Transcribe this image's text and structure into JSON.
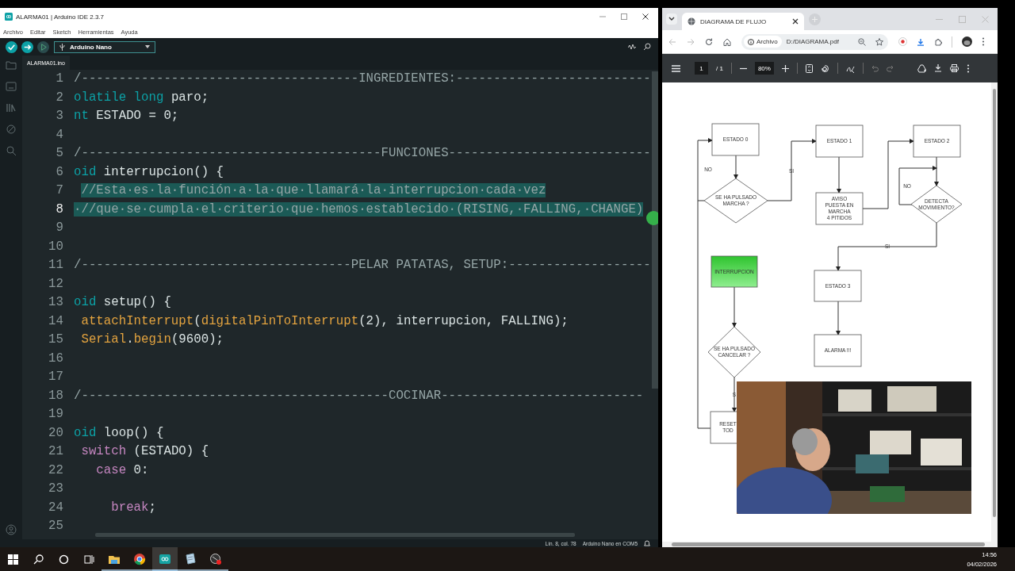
{
  "ide": {
    "title": "ALARMA01 | Arduino IDE 2.3.7",
    "menu": [
      "Archivo",
      "Editar",
      "Sketch",
      "Herramientas",
      "Ayuda"
    ],
    "toolbar_buttons": [
      {
        "kind": "verify",
        "disabled": false
      },
      {
        "kind": "upload",
        "disabled": false
      },
      {
        "kind": "debug",
        "disabled": true
      }
    ],
    "board": "Arduino Nano",
    "file_tab": "ALARMA01.ino",
    "code_lines": [
      {
        "number": "1",
        "current": false,
        "selected": false,
        "segments": [
          {
            "kind": "comment",
            "text": "/-------------------------------------INGREDIENTES:--------------------------"
          }
        ]
      },
      {
        "number": "2",
        "current": false,
        "selected": false,
        "segments": [
          {
            "kind": "keyword",
            "text": "olatile"
          },
          {
            "kind": "keyword",
            "text": " long"
          },
          {
            "kind": "plain",
            "text": " paro;"
          }
        ]
      },
      {
        "number": "3",
        "current": false,
        "selected": false,
        "segments": [
          {
            "kind": "keyword",
            "text": "nt"
          },
          {
            "kind": "plain",
            "text": " ESTADO = 0;"
          }
        ]
      },
      {
        "number": "4",
        "current": false,
        "selected": false
      },
      {
        "number": "5",
        "current": false,
        "selected": false,
        "segments": [
          {
            "kind": "comment",
            "text": "/----------------------------------------FUNCIONES---------------------------"
          }
        ]
      },
      {
        "number": "6",
        "current": false,
        "selected": false,
        "segments": [
          {
            "kind": "keyword",
            "text": "oid"
          },
          {
            "kind": "plain",
            "text": " interrupcion() {"
          }
        ]
      },
      {
        "number": "7",
        "current": false,
        "selected": true,
        "segments": [
          {
            "kind": "comment",
            "text": " //Esta·es·la·función·a·la·que·llamará·la·interrupcion·cada·vez"
          }
        ]
      },
      {
        "number": "8",
        "current": true,
        "selected": true,
        "segments": [
          {
            "kind": "comment",
            "text": "·//que·se·cumpla·el·criterio·que·hemos·establecido·(RISING,·FALLING,·CHANGE)"
          }
        ]
      },
      {
        "number": "9",
        "current": false,
        "selected": false
      },
      {
        "number": "10",
        "current": false,
        "selected": false
      },
      {
        "number": "11",
        "current": false,
        "selected": false,
        "segments": [
          {
            "kind": "comment",
            "text": "/------------------------------------PELAR PATATAS, SETUP:-------------------"
          }
        ]
      },
      {
        "number": "12",
        "current": false,
        "selected": false
      },
      {
        "number": "13",
        "current": false,
        "selected": false,
        "segments": [
          {
            "kind": "keyword",
            "text": "oid"
          },
          {
            "kind": "plain",
            "text": " setup() {"
          }
        ]
      },
      {
        "number": "14",
        "current": false,
        "selected": false,
        "segments": [
          {
            "kind": "builtin",
            "text": " attachInterrupt"
          },
          {
            "kind": "plain",
            "text": "("
          },
          {
            "kind": "builtin",
            "text": "digitalPinToInterrupt"
          },
          {
            "kind": "plain",
            "text": "(2), interrupcion, FALLING);"
          }
        ]
      },
      {
        "number": "15",
        "current": false,
        "selected": false,
        "segments": [
          {
            "kind": "builtin",
            "text": " Serial"
          },
          {
            "kind": "plain",
            "text": "."
          },
          {
            "kind": "builtin",
            "text": "begin"
          },
          {
            "kind": "plain",
            "text": "(9600);"
          }
        ]
      },
      {
        "number": "16",
        "current": false,
        "selected": false
      },
      {
        "number": "17",
        "current": false,
        "selected": false
      },
      {
        "number": "18",
        "current": false,
        "selected": false,
        "segments": [
          {
            "kind": "comment",
            "text": "/-----------------------------------------COCINAR---------------------------"
          }
        ]
      },
      {
        "number": "19",
        "current": false,
        "selected": false
      },
      {
        "number": "20",
        "current": false,
        "selected": false,
        "segments": [
          {
            "kind": "keyword",
            "text": "oid"
          },
          {
            "kind": "plain",
            "text": " loop() {"
          }
        ]
      },
      {
        "number": "21",
        "current": false,
        "selected": false,
        "segments": [
          {
            "kind": "control",
            "text": " switch"
          },
          {
            "kind": "plain",
            "text": " (ESTADO) {"
          }
        ]
      },
      {
        "number": "22",
        "current": false,
        "selected": false,
        "segments": [
          {
            "kind": "control",
            "text": "   case"
          },
          {
            "kind": "plain",
            "text": " 0:"
          }
        ]
      },
      {
        "number": "23",
        "current": false,
        "selected": false
      },
      {
        "number": "24",
        "current": false,
        "selected": false,
        "segments": [
          {
            "kind": "control",
            "text": "     break"
          },
          {
            "kind": "plain",
            "text": ";"
          }
        ]
      },
      {
        "number": "25",
        "current": false,
        "selected": false
      }
    ],
    "status_bar": {
      "position": "Lín. 8, col. 78",
      "board_port": "Arduino Nano en COM5"
    }
  },
  "browser": {
    "tab": {
      "title": "DIAGRAMA DE FLUJO"
    },
    "address": {
      "chip": "Archivo",
      "url": "D:/DIAGRAMA.pdf"
    },
    "pdf_toolbar": {
      "page": "1",
      "page_count": "/ 1",
      "zoom": "80%"
    },
    "flowchart": {
      "nodes": [
        {
          "kind": "box",
          "lines": [
            "ESTADO 0"
          ]
        },
        {
          "kind": "box",
          "lines": [
            "ESTADO 1"
          ]
        },
        {
          "kind": "box",
          "lines": [
            "ESTADO 2"
          ]
        },
        {
          "kind": "decision",
          "lines": [
            "SE HA PULSADO",
            "MARCHA ?"
          ]
        },
        {
          "kind": "box",
          "lines": [
            "AVISO",
            "PUESTA EN",
            "MARCHA",
            "4 PITIDOS"
          ]
        },
        {
          "kind": "decision",
          "lines": [
            "DETECTA",
            "MOVIMIENTO?"
          ]
        },
        {
          "kind": "event",
          "lines": [
            "INTERRUPCION"
          ]
        },
        {
          "kind": "box",
          "lines": [
            "ESTADO 3"
          ]
        },
        {
          "kind": "box",
          "lines": [
            "ALARMA !!!"
          ]
        },
        {
          "kind": "decision",
          "lines": [
            "SE HA PULSADO",
            "CANCELAR ?"
          ]
        },
        {
          "kind": "box",
          "lines": [
            "RESET",
            "TOD"
          ]
        }
      ],
      "edge_labels": [
        "NO",
        "SI",
        "NO",
        "SI",
        "S"
      ]
    }
  },
  "taskbar": {
    "apps": [
      {
        "kind": "explorer",
        "selected": false
      },
      {
        "kind": "browser",
        "selected": false
      },
      {
        "kind": "arduino",
        "selected": true
      },
      {
        "kind": "notepad",
        "selected": false
      },
      {
        "kind": "recorder",
        "selected": false
      }
    ],
    "time": "14:56",
    "date": "04/02/2026"
  }
}
